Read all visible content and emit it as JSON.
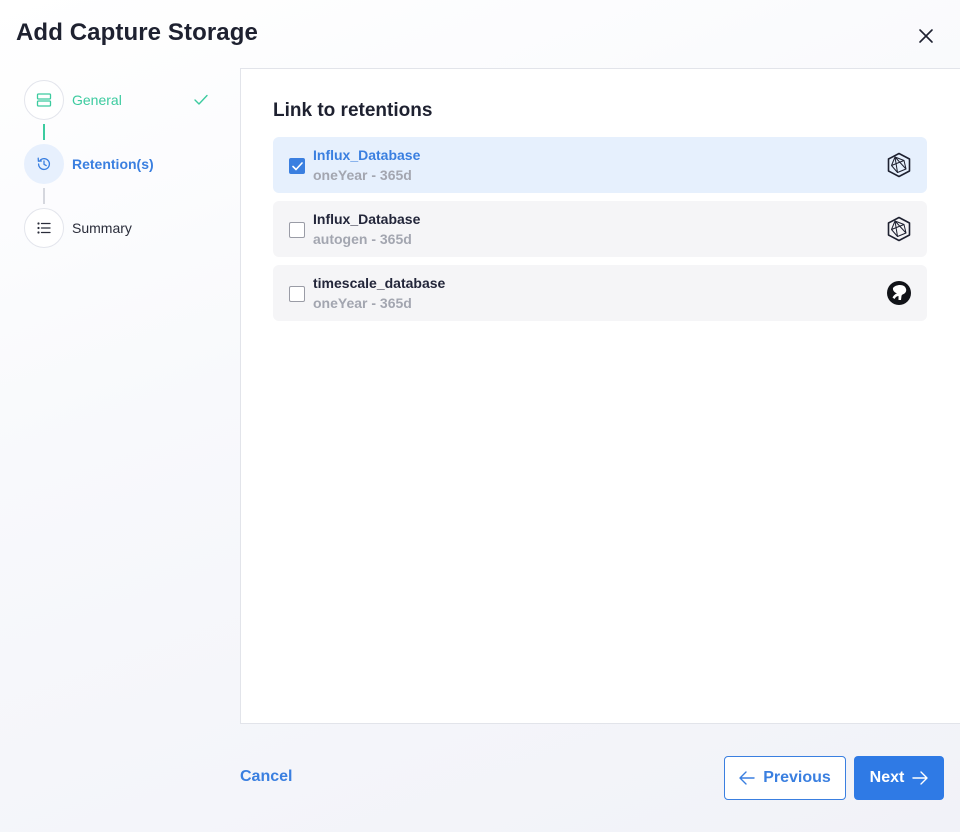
{
  "dialog": {
    "title": "Add Capture Storage",
    "close_icon": "close-icon"
  },
  "stepper": {
    "steps": [
      {
        "label": "General",
        "status": "done",
        "icon": "storage-icon"
      },
      {
        "label": "Retention(s)",
        "status": "active",
        "icon": "history-icon"
      },
      {
        "label": "Summary",
        "status": "pending",
        "icon": "list-icon"
      }
    ]
  },
  "retentions": {
    "title": "Link to retentions",
    "items": [
      {
        "name": "Influx_Database",
        "detail": "oneYear - 365d",
        "checked": true,
        "icon": "influxdb-icon"
      },
      {
        "name": "Influx_Database",
        "detail": "autogen - 365d",
        "checked": false,
        "icon": "influxdb-icon"
      },
      {
        "name": "timescale_database",
        "detail": "oneYear - 365d",
        "checked": false,
        "icon": "timescale-icon"
      }
    ]
  },
  "footer": {
    "cancel_label": "Cancel",
    "previous_label": "Previous",
    "next_label": "Next"
  },
  "colors": {
    "accent": "#3a7fe0",
    "success": "#3ccb9f",
    "selected_bg": "#e6f0fd"
  }
}
